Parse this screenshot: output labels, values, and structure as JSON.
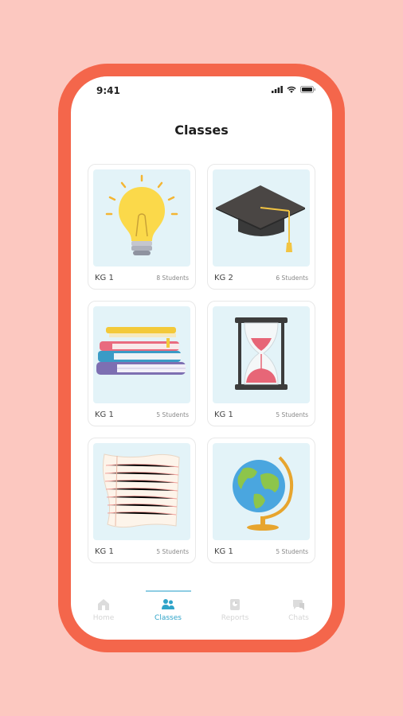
{
  "status_bar": {
    "time": "9:41"
  },
  "page": {
    "title": "Classes"
  },
  "classes": [
    {
      "name": "KG 1",
      "students": "8 Students",
      "image": "light-bulb-icon"
    },
    {
      "name": "KG 2",
      "students": "6 Students",
      "image": "graduation-cap-icon"
    },
    {
      "name": "KG 1",
      "students": "5 Students",
      "image": "books-icon"
    },
    {
      "name": "KG 1",
      "students": "5 Students",
      "image": "hourglass-icon"
    },
    {
      "name": "KG 1",
      "students": "5 Students",
      "image": "paper-sheet-icon"
    },
    {
      "name": "KG 1",
      "students": "5 Students",
      "image": "globe-icon"
    }
  ],
  "tabs": [
    {
      "label": "Home",
      "icon": "home-icon",
      "active": false
    },
    {
      "label": "Classes",
      "icon": "students-icon",
      "active": true
    },
    {
      "label": "Reports",
      "icon": "reports-icon",
      "active": false
    },
    {
      "label": "Chats",
      "icon": "chat-icon",
      "active": false
    }
  ],
  "colors": {
    "background": "#fcc8c0",
    "frame": "#f4664b",
    "accent": "#2fa4c9",
    "card_image_bg": "#e3f3f8"
  }
}
